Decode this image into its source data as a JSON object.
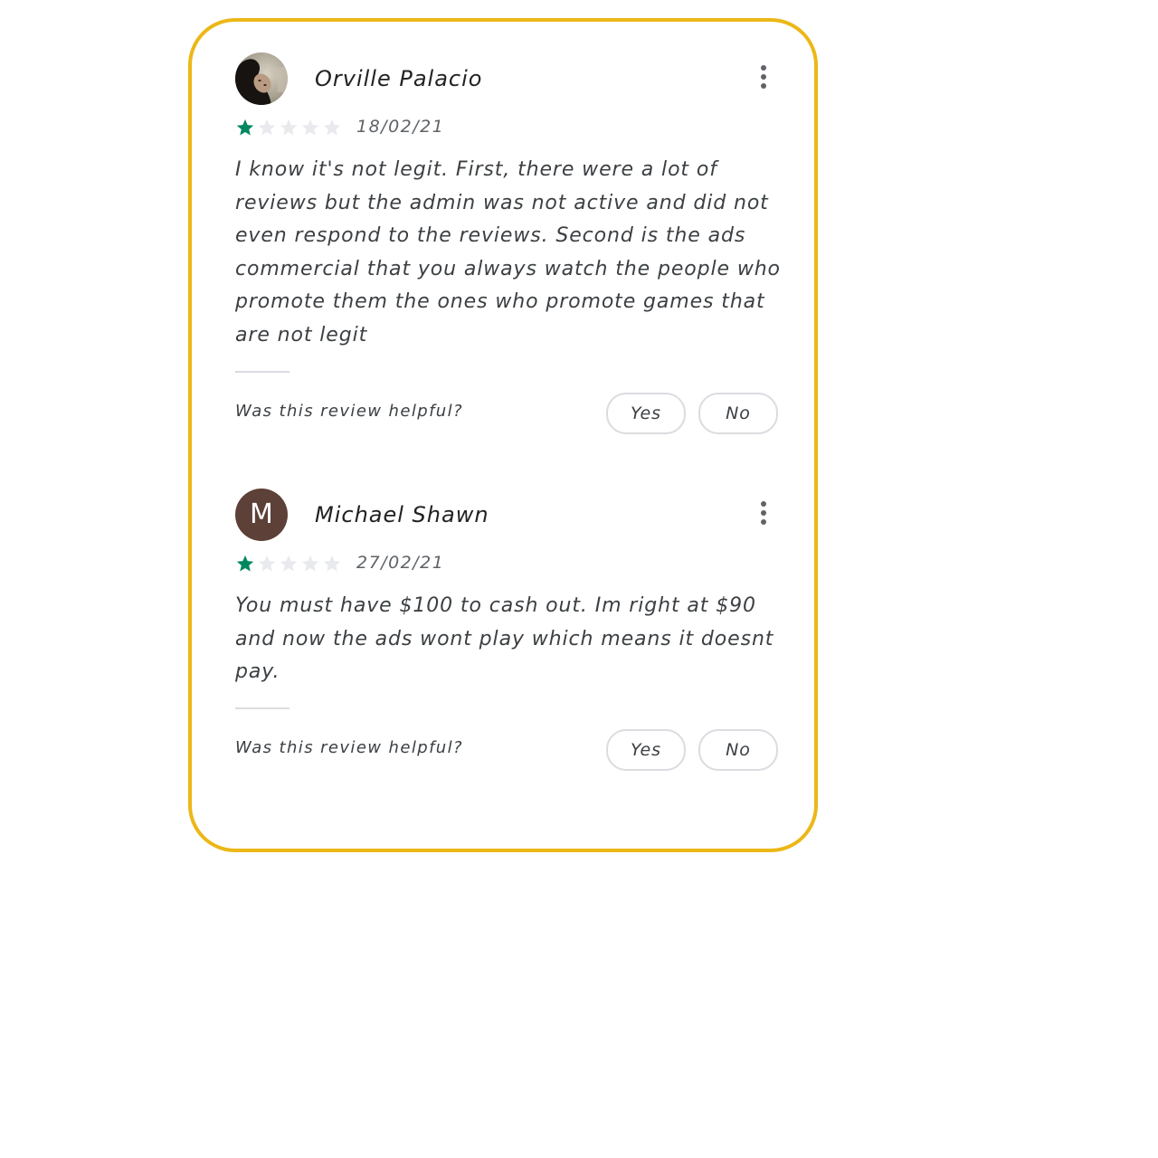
{
  "colors": {
    "card_border": "#ecb717",
    "star_filled": "#01875f",
    "star_empty": "#e8eaed",
    "avatar_letter_bg": "#5d4037"
  },
  "reviews": [
    {
      "name": "Orville Palacio",
      "avatar": {
        "type": "photo",
        "icon": "user-photo"
      },
      "rating": 1,
      "max_rating": 5,
      "date": "18/02/21",
      "text": "I know it's not legit. First, there were a lot of reviews but the admin was not active and did not even respond to the reviews. Second is the ads commercial that you always watch the people who promote them the ones who promote games that are not legit",
      "helpful_prompt": "Was this review helpful?",
      "yes_label": "Yes",
      "no_label": "No",
      "menu_icon": "more-vert-icon"
    },
    {
      "name": "Michael Shawn",
      "avatar": {
        "type": "letter",
        "letter": "M"
      },
      "rating": 1,
      "max_rating": 5,
      "date": "27/02/21",
      "text": "You must have $100 to cash out. Im right at $90 and now the ads wont play which means it doesnt pay.",
      "helpful_prompt": "Was this review helpful?",
      "yes_label": "Yes",
      "no_label": "No",
      "menu_icon": "more-vert-icon"
    }
  ]
}
